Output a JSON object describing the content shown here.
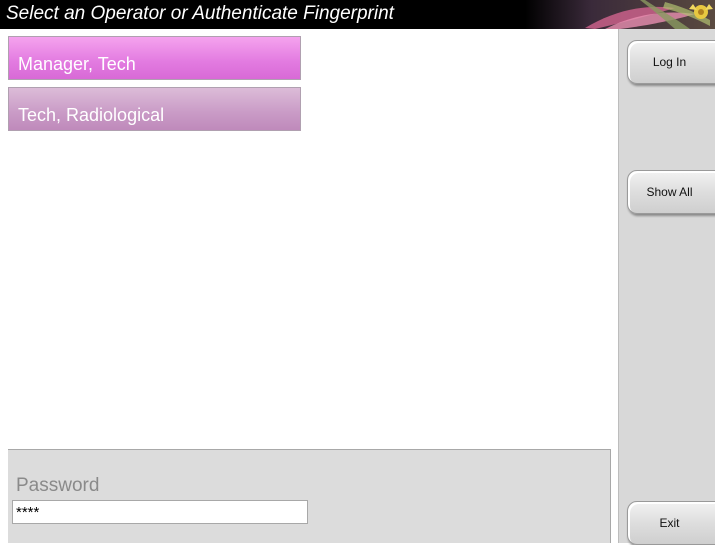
{
  "header": {
    "title": "Select an Operator or Authenticate Fingerprint"
  },
  "operators": [
    {
      "name": "Manager, Tech",
      "selected": true
    },
    {
      "name": "Tech, Radiological",
      "selected": false
    }
  ],
  "password": {
    "label": "Password",
    "value": "****"
  },
  "sidebar": {
    "login_label": "Log In",
    "show_all_label": "Show All",
    "exit_label": "Exit"
  },
  "colors": {
    "selected_operator": "#e27ae0",
    "operator": "#c99ac6",
    "titlebar": "#000000",
    "sidebar": "#d8d8d8"
  },
  "icons": {
    "header_decoration": "flower-decoration-icon"
  }
}
